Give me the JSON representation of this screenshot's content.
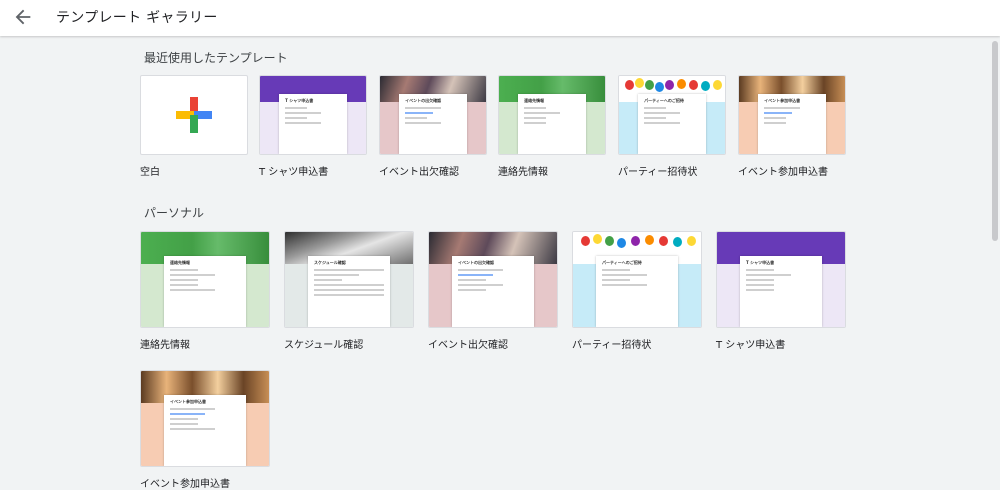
{
  "header": {
    "title": "テンプレート ギャラリー",
    "back_icon": "arrow-left-icon"
  },
  "sections": {
    "recent": {
      "title": "最近使用したテンプレート",
      "items": [
        {
          "label": "空白"
        },
        {
          "label": "T シャツ申込書",
          "preview_title": "T シャツ申込書"
        },
        {
          "label": "イベント出欠確認",
          "preview_title": "イベントの出欠確認"
        },
        {
          "label": "連絡先情報",
          "preview_title": "連絡先情報"
        },
        {
          "label": "パーティー招待状",
          "preview_title": "パーティーへのご招待"
        },
        {
          "label": "イベント参加申込書",
          "preview_title": "イベント参加申込書"
        }
      ]
    },
    "personal": {
      "title": "パーソナル",
      "items": [
        {
          "label": "連絡先情報",
          "preview_title": "連絡先情報"
        },
        {
          "label": "スケジュール確認",
          "preview_title": "スケジュール確認"
        },
        {
          "label": "イベント出欠確認",
          "preview_title": "イベントの出欠確認"
        },
        {
          "label": "パーティー招待状",
          "preview_title": "パーティーへのご招待"
        },
        {
          "label": "T シャツ申込書",
          "preview_title": "T シャツ申込書"
        },
        {
          "label": "イベント参加申込書",
          "preview_title": "イベント参加申込書"
        }
      ]
    }
  },
  "colors": {
    "tshirt_band": "#673ab7",
    "tshirt_side": "#ede7f6",
    "event_side": "#e6c7c9",
    "contact_side": "#d4e8cf",
    "party_side": "#c6ebf8",
    "apply_side": "#f7ccb3",
    "sched_side": "#e3e9e8"
  }
}
